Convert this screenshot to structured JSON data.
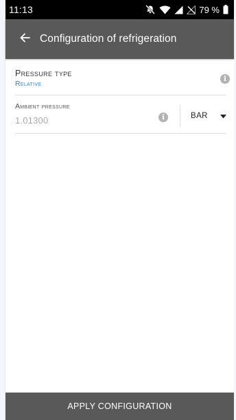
{
  "status_bar": {
    "time": "11:13",
    "battery": "79 %",
    "icons": [
      "bell-muted-icon",
      "wifi-icon",
      "signal-icon",
      "no-signal-icon",
      "battery-icon"
    ]
  },
  "app_bar": {
    "title": "Configuration of refrigeration",
    "back_icon": "arrow-left-icon",
    "background": "#595959"
  },
  "pressure_type": {
    "label": "Pressure type",
    "value": "Relative",
    "value_color": "#3f7fc4",
    "info_icon": "info-icon"
  },
  "ambient_pressure": {
    "label": "Ambient pressure",
    "value": "1.01300",
    "info_icon": "info-icon",
    "unit": "BAR",
    "unit_dropdown_icon": "caret-down-icon"
  },
  "footer": {
    "apply_label": "APPLY CONFIGURATION"
  }
}
